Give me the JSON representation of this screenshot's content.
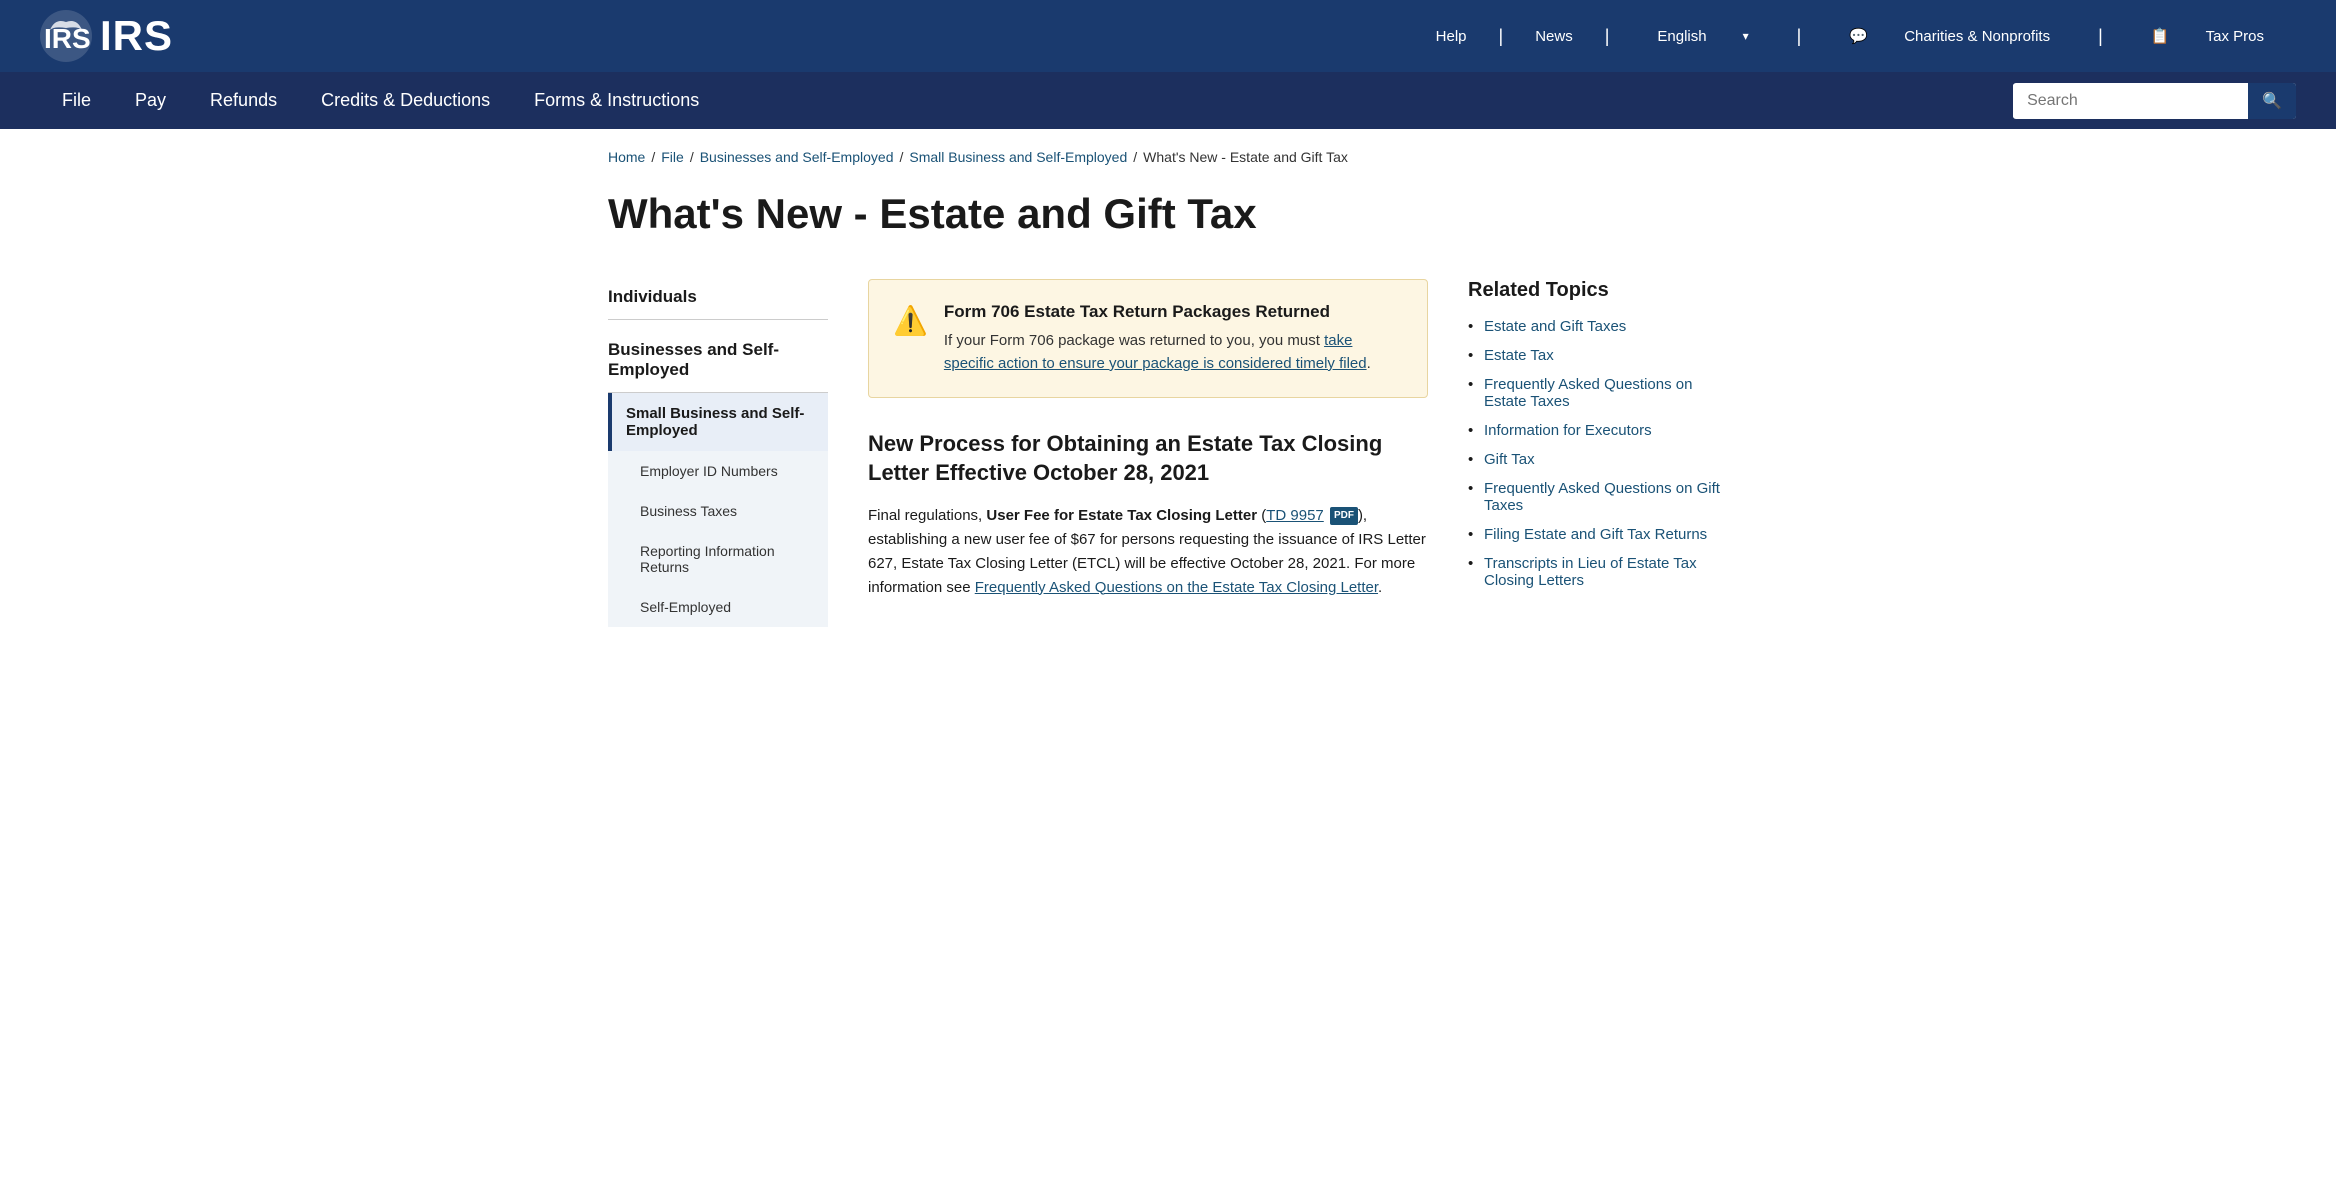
{
  "topBar": {
    "logoText": "IRS",
    "links": [
      {
        "label": "Help",
        "id": "help"
      },
      {
        "label": "News",
        "id": "news"
      },
      {
        "label": "English",
        "id": "english",
        "hasChevron": true
      },
      {
        "label": "Charities & Nonprofits",
        "id": "charities"
      },
      {
        "label": "Tax Pros",
        "id": "taxpros"
      }
    ]
  },
  "navBar": {
    "links": [
      {
        "label": "File",
        "id": "file"
      },
      {
        "label": "Pay",
        "id": "pay"
      },
      {
        "label": "Refunds",
        "id": "refunds"
      },
      {
        "label": "Credits & Deductions",
        "id": "credits"
      },
      {
        "label": "Forms & Instructions",
        "id": "forms"
      }
    ],
    "search": {
      "placeholder": "Search",
      "value": ""
    }
  },
  "breadcrumb": {
    "items": [
      {
        "label": "Home",
        "link": true
      },
      {
        "label": "File",
        "link": true
      },
      {
        "label": "Businesses and Self-Employed",
        "link": true
      },
      {
        "label": "Small Business and Self-Employed",
        "link": true
      },
      {
        "label": "What's New - Estate and Gift Tax",
        "link": false
      }
    ]
  },
  "pageTitle": "What's New - Estate and Gift Tax",
  "sidebar": {
    "sections": [
      {
        "title": "Individuals",
        "items": []
      },
      {
        "title": "Businesses and Self-Employed",
        "active": true,
        "items": [
          {
            "label": "Small Business and Self-Employed",
            "active": true
          },
          {
            "label": "Employer ID Numbers",
            "sub": true
          },
          {
            "label": "Business Taxes",
            "sub": true
          },
          {
            "label": "Reporting Information Returns",
            "sub": true
          },
          {
            "label": "Self-Employed",
            "sub": true
          }
        ]
      }
    ]
  },
  "noticeBox": {
    "title": "Form 706 Estate Tax Return Packages Returned",
    "body": "If your Form 706 package was returned to you, you must ",
    "linkText": "take specific action to ensure your package is considered timely filed",
    "bodyEnd": "."
  },
  "articleSection": {
    "heading": "New Process for Obtaining an Estate Tax Closing Letter Effective October 28, 2021",
    "body": "Final regulations, ",
    "boldText": "User Fee for Estate Tax Closing Letter",
    "linkTD": "TD 9957",
    "pdfBadge": "PDF",
    "bodyRest": "), establishing a new user fee of $67 for persons requesting the issuance of IRS Letter 627, Estate Tax Closing Letter (ETCL) will be effective October 28, 2021. For more information see ",
    "linkFAQ": "Frequently Asked Questions on the Estate Tax Closing Letter",
    "bodyEnd": "."
  },
  "relatedTopics": {
    "title": "Related Topics",
    "items": [
      {
        "label": "Estate and Gift Taxes"
      },
      {
        "label": "Estate Tax"
      },
      {
        "label": "Frequently Asked Questions on Estate Taxes"
      },
      {
        "label": "Information for Executors"
      },
      {
        "label": "Gift Tax"
      },
      {
        "label": "Frequently Asked Questions on Gift Taxes"
      },
      {
        "label": "Filing Estate and Gift Tax Returns"
      },
      {
        "label": "Transcripts in Lieu of Estate Tax Closing Letters"
      }
    ]
  }
}
